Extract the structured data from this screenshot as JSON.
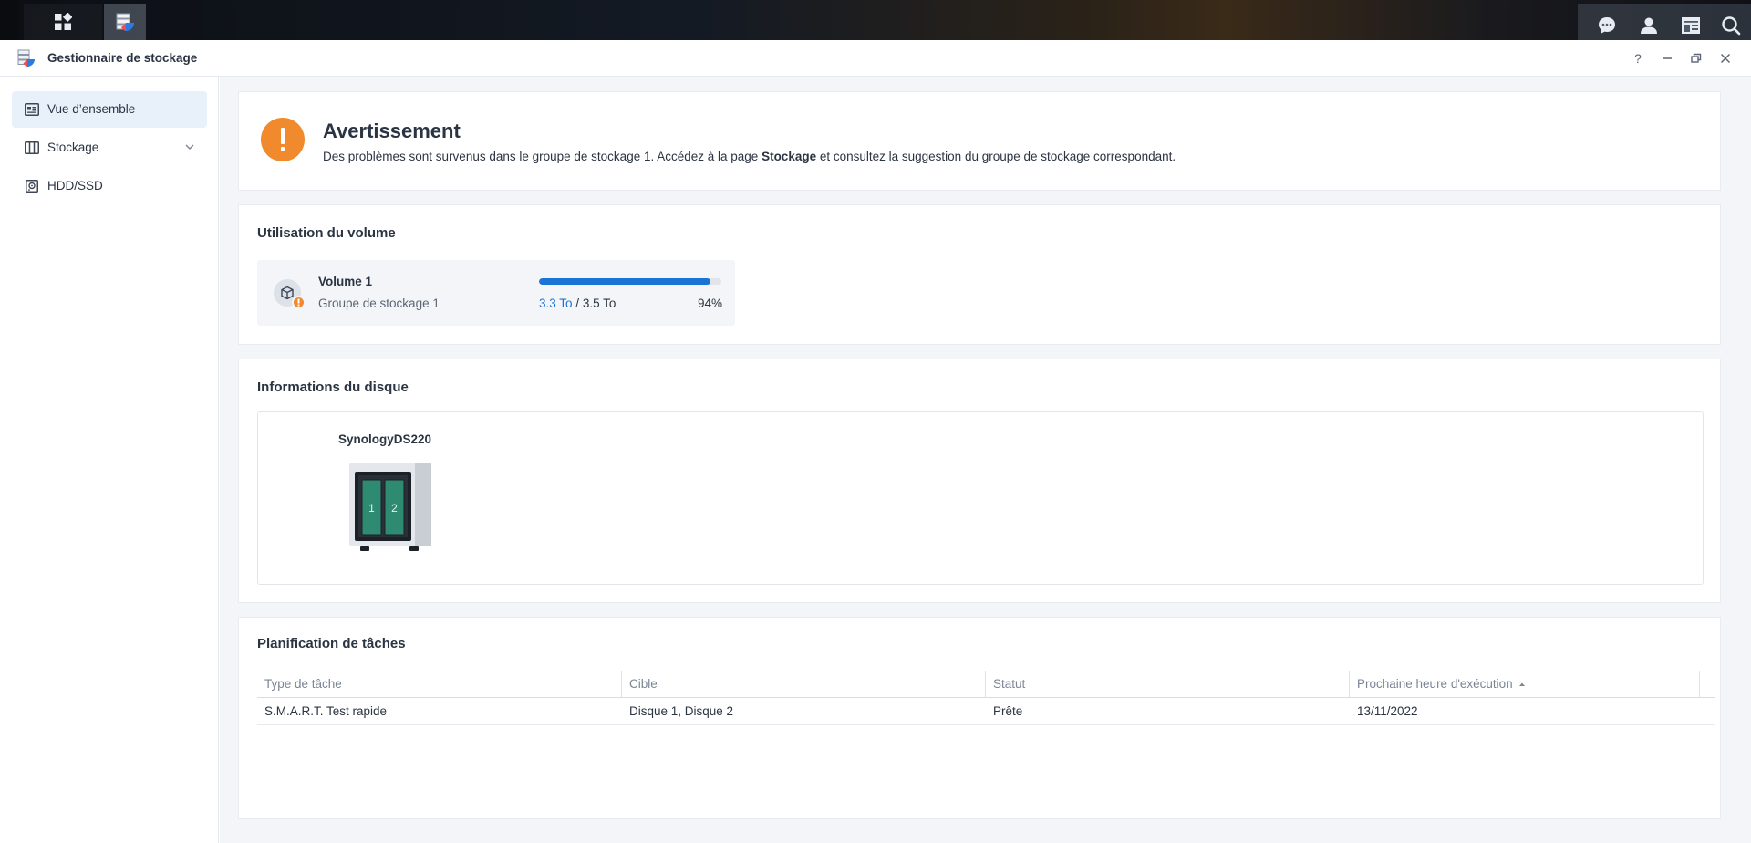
{
  "window": {
    "title": "Gestionnaire de stockage",
    "help_label": "?"
  },
  "sidebar": {
    "items": [
      {
        "label": "Vue d’ensemble",
        "icon": "overview-icon",
        "active": true
      },
      {
        "label": "Stockage",
        "icon": "storage-icon",
        "expandable": true
      },
      {
        "label": "HDD/SSD",
        "icon": "disk-icon"
      }
    ]
  },
  "warning": {
    "title": "Avertissement",
    "text_before": "Des problèmes sont survenus dans le groupe de stockage 1. Accédez à la page ",
    "text_bold": "Stockage",
    "text_after": " et consultez la suggestion du groupe de stockage correspondant."
  },
  "volume": {
    "section_title": "Utilisation du volume",
    "name": "Volume 1",
    "pool": "Groupe de stockage 1",
    "used": "3.3 To",
    "separator": " / ",
    "total": "3.5 To",
    "percent": "94%",
    "usage_fraction": 0.94
  },
  "disk": {
    "section_title": "Informations du disque",
    "device_name": "SynologyDS220",
    "bays": [
      "1",
      "2"
    ]
  },
  "tasks": {
    "section_title": "Planification de tâches",
    "columns": [
      "Type de tâche",
      "Cible",
      "Statut",
      "Prochaine heure d'exécution"
    ],
    "rows": [
      [
        "S.M.A.R.T. Test rapide",
        "Disque 1, Disque 2",
        "Prête",
        "13/11/2022"
      ]
    ]
  },
  "colors": {
    "accent": "#1a74d6",
    "warning": "#f08a2c",
    "disk_bay": "#2f8a72"
  }
}
